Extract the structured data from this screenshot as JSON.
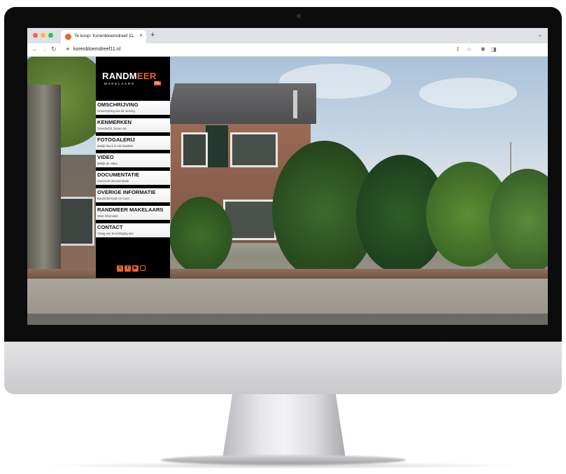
{
  "browser": {
    "tab_title": "Te koop: Korenbloemdreef 11, ",
    "tab_close": "×",
    "new_tab": "+",
    "url": "korenbloemdreef11.nl"
  },
  "site": {
    "logo": {
      "main_a": "RANDM",
      "main_b": "EER",
      "sub": "MAKELAARS",
      "nl": "NL"
    },
    "menu": [
      {
        "title": "OMSCHRIJVING",
        "subtitle": "Omschrijving van de woning"
      },
      {
        "title": "KENMERKEN",
        "subtitle": "Overdracht, bouw, etc."
      },
      {
        "title": "FOTOGALERIJ",
        "subtitle": "Bekijk foto's in HD kwaliteit"
      },
      {
        "title": "VIDEO",
        "subtitle": "Bekijk de video"
      },
      {
        "title": "DOCUMENTATIE",
        "subtitle": "Overzicht documentatie"
      },
      {
        "title": "OVERIGE INFORMATIE",
        "subtitle": "Buurtinformatie en meer"
      },
      {
        "title": "RANDMEER MAKELAARS",
        "subtitle": "Meer informatie"
      },
      {
        "title": "CONTACT",
        "subtitle": "Vraag een bezichtiging aan"
      }
    ],
    "social_icons": [
      "twitter-icon",
      "facebook-icon",
      "youtube-icon",
      "instagram-icon"
    ],
    "accent_color": "#e8642c"
  }
}
